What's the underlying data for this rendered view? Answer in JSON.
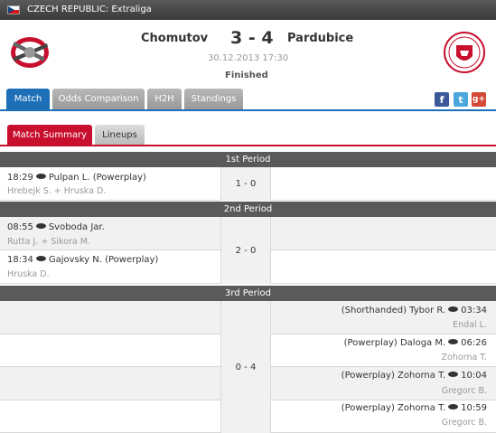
{
  "header": {
    "country_league": "CZECH REPUBLIC: Extraliga"
  },
  "match": {
    "home": "Chomutov",
    "away": "Pardubice",
    "score": "3 - 4",
    "datetime": "30.12.2013 17:30",
    "status": "Finished"
  },
  "tabs": [
    "Match",
    "Odds Comparison",
    "H2H",
    "Standings"
  ],
  "subtabs": [
    "Match Summary",
    "Lineups"
  ],
  "social": {
    "facebook": "f",
    "twitter": "t",
    "googleplus": "g+"
  },
  "periods": [
    {
      "title": "1st Period",
      "score": "1 - 0",
      "events": [
        {
          "side": "home",
          "time": "18:29",
          "scorer": "Pulpan L. (Powerplay)",
          "assist": "Hrebejk S. + Hruska D."
        }
      ]
    },
    {
      "title": "2nd Period",
      "score": "2 - 0",
      "events": [
        {
          "side": "home",
          "time": "08:55",
          "scorer": "Svoboda Jar.",
          "assist": "Rutta J. + Sikora M."
        },
        {
          "side": "home",
          "time": "18:34",
          "scorer": "Gajovsky N. (Powerplay)",
          "assist": "Hruska D."
        }
      ]
    },
    {
      "title": "3rd Period",
      "score": "0 - 4",
      "events": [
        {
          "side": "away",
          "time": "03:34",
          "scorer": "(Shorthanded) Tybor R.",
          "assist": "Endal L."
        },
        {
          "side": "away",
          "time": "06:26",
          "scorer": "(Powerplay) Daloga M.",
          "assist": "Zohorna T."
        },
        {
          "side": "away",
          "time": "10:04",
          "scorer": "(Powerplay) Zohorna T.",
          "assist": "Gregorc B."
        },
        {
          "side": "away",
          "time": "10:59",
          "scorer": "(Powerplay) Zohorna T.",
          "assist": "Gregorc B."
        }
      ]
    }
  ],
  "colors": {
    "tab_active": "#1d6fb8",
    "subtab_active": "#c8102e",
    "period_header": "#5a5a5a"
  }
}
